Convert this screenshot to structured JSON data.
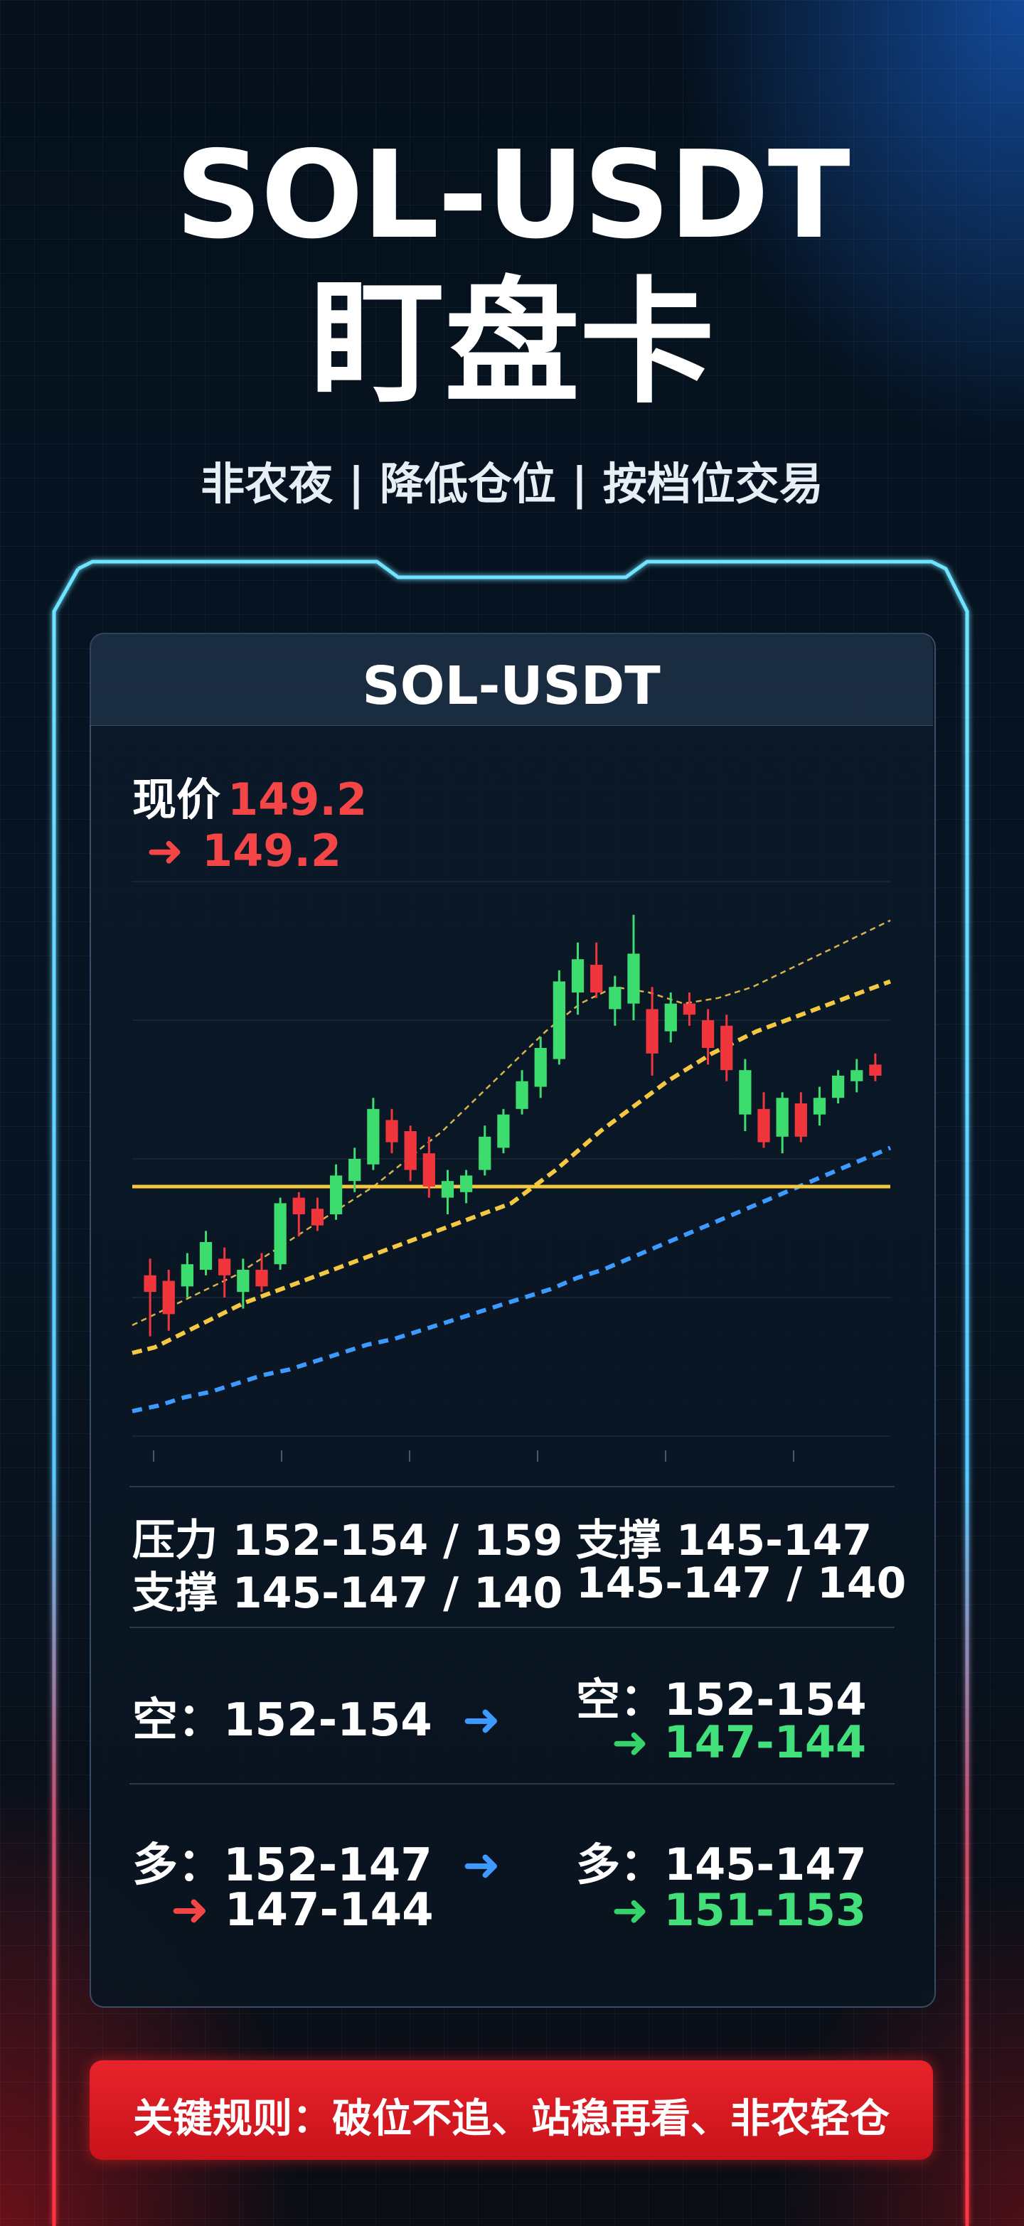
{
  "header": {
    "title": "SOL-USDT",
    "subtitle": "盯盘卡",
    "tagline": "非农夜 | 降低仓位 | 按档位交易"
  },
  "card": {
    "title": "SOL-USDT",
    "price_label": "现价",
    "price_value": "149.2",
    "price_arrow": "➜",
    "price_value_2": "149.2"
  },
  "levels": {
    "left_resistance": "压力 152-154 / 159",
    "left_support": "支撑 145-147 / 140",
    "right_support": "支撑 145-147",
    "right_support_2": "145-147 / 140"
  },
  "short": {
    "left_label": "空：",
    "left_range": "152-154",
    "left_arrow": "➜",
    "right_label": "空：",
    "right_range": "152-154",
    "right_arrow": "➜",
    "right_target": "147-144"
  },
  "long": {
    "left_label": "多：",
    "left_range": "152-147",
    "left_arrow": "➜",
    "left_arrow_2": "➜",
    "left_target": "147-144",
    "right_label": "多：",
    "right_range": "145-147",
    "right_arrow": "➜",
    "right_target": "151-153"
  },
  "rule": {
    "text": "关键规则：破位不追、站稳再看、非农轻仓"
  },
  "colors": {
    "up": "#3ddc6e",
    "down": "#f0363c",
    "accent_blue": "#3d9bff",
    "accent_red": "#e8232b",
    "ma_yellow": "#f5c842"
  },
  "chart_data": {
    "type": "candlestick",
    "ylim": [
      138,
      158
    ],
    "candles": [
      {
        "o": 143.8,
        "h": 144.4,
        "l": 141.6,
        "c": 143.2
      },
      {
        "o": 143.6,
        "h": 144.0,
        "l": 141.8,
        "c": 142.4
      },
      {
        "o": 143.4,
        "h": 144.6,
        "l": 143.0,
        "c": 144.2
      },
      {
        "o": 144.0,
        "h": 145.4,
        "l": 143.8,
        "c": 145.0
      },
      {
        "o": 144.4,
        "h": 144.8,
        "l": 143.0,
        "c": 143.8
      },
      {
        "o": 143.2,
        "h": 144.4,
        "l": 142.6,
        "c": 144.0
      },
      {
        "o": 144.0,
        "h": 144.6,
        "l": 143.2,
        "c": 143.4
      },
      {
        "o": 144.2,
        "h": 146.6,
        "l": 144.0,
        "c": 146.4
      },
      {
        "o": 146.6,
        "h": 146.8,
        "l": 145.2,
        "c": 146.0
      },
      {
        "o": 146.2,
        "h": 146.6,
        "l": 145.4,
        "c": 145.6
      },
      {
        "o": 146.0,
        "h": 147.8,
        "l": 145.8,
        "c": 147.4
      },
      {
        "o": 147.2,
        "h": 148.4,
        "l": 146.8,
        "c": 148.0
      },
      {
        "o": 147.8,
        "h": 150.2,
        "l": 147.6,
        "c": 149.8
      },
      {
        "o": 149.4,
        "h": 149.8,
        "l": 148.2,
        "c": 148.6
      },
      {
        "o": 149.0,
        "h": 149.2,
        "l": 147.2,
        "c": 147.6
      },
      {
        "o": 148.2,
        "h": 148.8,
        "l": 146.6,
        "c": 147.0
      },
      {
        "o": 146.6,
        "h": 147.6,
        "l": 146.0,
        "c": 147.2
      },
      {
        "o": 146.8,
        "h": 147.6,
        "l": 146.4,
        "c": 147.4
      },
      {
        "o": 147.6,
        "h": 149.2,
        "l": 147.4,
        "c": 148.8
      },
      {
        "o": 148.4,
        "h": 149.8,
        "l": 148.2,
        "c": 149.6
      },
      {
        "o": 149.8,
        "h": 151.2,
        "l": 149.6,
        "c": 150.8
      },
      {
        "o": 150.6,
        "h": 152.4,
        "l": 150.2,
        "c": 152.0
      },
      {
        "o": 151.6,
        "h": 154.8,
        "l": 151.4,
        "c": 154.4
      },
      {
        "o": 154.0,
        "h": 155.8,
        "l": 153.2,
        "c": 155.2
      },
      {
        "o": 155.0,
        "h": 155.8,
        "l": 153.8,
        "c": 154.0
      },
      {
        "o": 153.4,
        "h": 154.6,
        "l": 152.8,
        "c": 154.2
      },
      {
        "o": 153.6,
        "h": 156.8,
        "l": 153.0,
        "c": 155.4
      },
      {
        "o": 153.4,
        "h": 154.2,
        "l": 151.0,
        "c": 151.8
      },
      {
        "o": 152.6,
        "h": 154.0,
        "l": 152.2,
        "c": 153.6
      },
      {
        "o": 153.6,
        "h": 154.0,
        "l": 152.8,
        "c": 153.2
      },
      {
        "o": 153.0,
        "h": 153.4,
        "l": 151.4,
        "c": 152.0
      },
      {
        "o": 152.8,
        "h": 153.2,
        "l": 150.8,
        "c": 151.2
      },
      {
        "o": 149.6,
        "h": 151.6,
        "l": 149.0,
        "c": 151.2
      },
      {
        "o": 149.8,
        "h": 150.4,
        "l": 148.4,
        "c": 148.6
      },
      {
        "o": 148.8,
        "h": 150.4,
        "l": 148.2,
        "c": 150.2
      },
      {
        "o": 150.0,
        "h": 150.4,
        "l": 148.6,
        "c": 148.8
      },
      {
        "o": 149.6,
        "h": 150.6,
        "l": 149.2,
        "c": 150.2
      },
      {
        "o": 150.2,
        "h": 151.2,
        "l": 150.0,
        "c": 151.0
      },
      {
        "o": 150.8,
        "h": 151.6,
        "l": 150.4,
        "c": 151.2
      },
      {
        "o": 151.4,
        "h": 151.8,
        "l": 150.8,
        "c": 151.0
      }
    ],
    "horizontal_line": 147.0,
    "ma_yellow": [
      141.0,
      141.2,
      141.6,
      142.0,
      142.4,
      142.8,
      143.1,
      143.4,
      143.7,
      144.0,
      144.3,
      144.6,
      144.9,
      145.2,
      145.5,
      145.8,
      146.1,
      146.4,
      147.0,
      147.6,
      148.3,
      149.0,
      149.6,
      150.2,
      150.8,
      151.3,
      151.8,
      152.2,
      152.6,
      152.9,
      153.2,
      153.5,
      153.8,
      154.1,
      154.4
    ],
    "ma_blue": [
      138.9,
      139.1,
      139.4,
      139.6,
      139.9,
      140.2,
      140.4,
      140.7,
      141.0,
      141.3,
      141.5,
      141.8,
      142.1,
      142.4,
      142.7,
      143.0,
      143.3,
      143.7,
      144.0,
      144.4,
      144.8,
      145.2,
      145.6,
      146.0,
      146.4,
      146.8,
      147.2,
      147.6,
      148.0,
      148.4
    ],
    "ma_thin_dashed": [
      142.0,
      142.6,
      143.2,
      143.8,
      144.6,
      145.4,
      146.2,
      147.0,
      148.0,
      149.0,
      150.2,
      151.4,
      152.6,
      153.6,
      154.2,
      154.0,
      153.6,
      153.8,
      154.2,
      154.8,
      155.4,
      156.0,
      156.6
    ]
  }
}
